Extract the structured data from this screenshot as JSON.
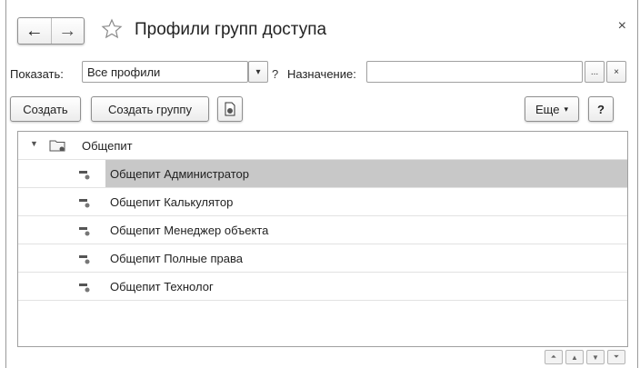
{
  "window": {
    "title": "Профили групп доступа",
    "close_label": "×",
    "back_label": "←",
    "forward_label": "→"
  },
  "filter": {
    "show_label": "Показать:",
    "show_value": "Все профили",
    "help_label": "?",
    "purpose_label": "Назначение:",
    "purpose_value": "",
    "ellipsis_label": "...",
    "clear_label": "×"
  },
  "toolbar": {
    "create_label": "Создать",
    "create_group_label": "Создать группу",
    "more_label": "Еще",
    "help_label": "?"
  },
  "list": {
    "group": {
      "label": "Общепит"
    },
    "items": [
      {
        "label": "Общепит Администратор",
        "selected": true
      },
      {
        "label": "Общепит Калькулятор",
        "selected": false
      },
      {
        "label": "Общепит Менеджер объекта",
        "selected": false
      },
      {
        "label": "Общепит Полные права",
        "selected": false
      },
      {
        "label": "Общепит Технолог",
        "selected": false
      }
    ]
  },
  "icons": {
    "back": "arrow-left-icon",
    "forward": "arrow-right-icon",
    "favorite": "star-icon",
    "copy": "copy-document-icon",
    "group": "folder-icon",
    "item": "profile-item-icon"
  }
}
